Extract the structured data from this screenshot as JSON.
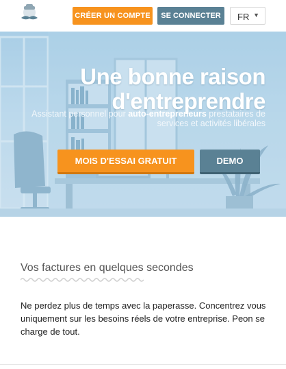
{
  "header": {
    "logo_icon": "mustache-mascot-icon",
    "create_account_label": "CRÉER UN COMPTE",
    "login_label": "SE CONNECTER",
    "language": {
      "selected": "FR",
      "caret_icon": "chevron-down-icon"
    }
  },
  "hero": {
    "title_line1": "Une bonne raison",
    "title_line2": "d'entreprendre",
    "subtitle_pre": "Assistant personnel pour ",
    "subtitle_bold": "auto-entrepreneurs",
    "subtitle_post": " prestataires de services et activités libérales",
    "trial_label": "MOIS D'ESSAI GRATUIT",
    "demo_label": "DEMO"
  },
  "main": {
    "title": "Vos factures en quelques secondes",
    "text": "Ne perdez plus de temps avec la paperasse. Concentrez vous uniquement sur les besoins réels de votre entreprise. Peon se charge de tout."
  },
  "colors": {
    "accent_orange": "#f7931e",
    "accent_slate": "#5a8194",
    "hero_bg": "#b7d6ea"
  }
}
